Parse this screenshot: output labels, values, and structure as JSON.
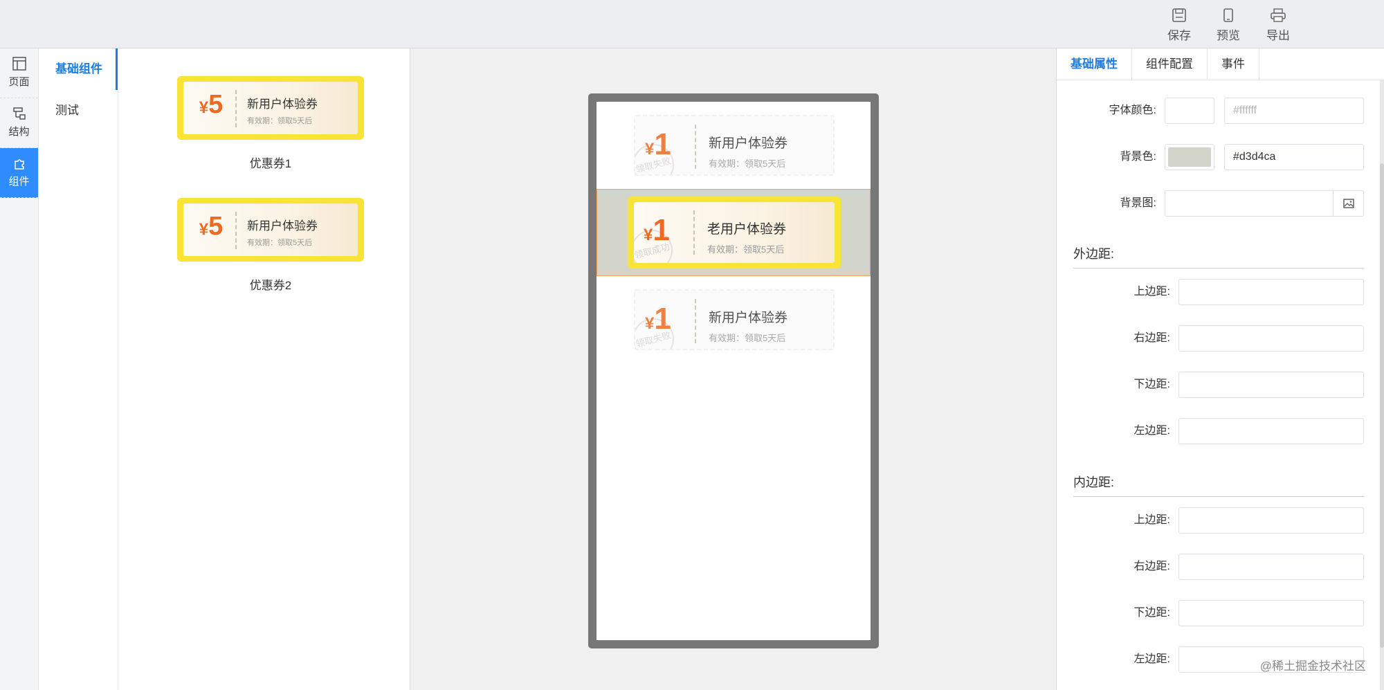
{
  "toolbar": {
    "save": "保存",
    "preview": "预览",
    "export": "导出"
  },
  "rail": {
    "page": "页面",
    "structure": "结构",
    "component": "组件"
  },
  "categories": [
    "基础组件",
    "测试"
  ],
  "library": [
    {
      "yen": "¥",
      "amount": "5",
      "title": "新用户体验券",
      "sub": "有效期：领取5天后",
      "label": "优惠券1"
    },
    {
      "yen": "¥",
      "amount": "5",
      "title": "新用户体验券",
      "sub": "有效期：领取5天后",
      "label": "优惠券2"
    }
  ],
  "canvas": [
    {
      "yen": "¥",
      "amount": "1",
      "title": "新用户体验券",
      "sub": "有效期：领取5天后",
      "stamp": "领取失败"
    },
    {
      "yen": "¥",
      "amount": "1",
      "title": "老用户体验券",
      "sub": "有效期：领取5天后",
      "stamp": "领取成功"
    },
    {
      "yen": "¥",
      "amount": "1",
      "title": "新用户体验券",
      "sub": "有效期：领取5天后",
      "stamp": "领取失败"
    }
  ],
  "props": {
    "tabs": [
      "基础属性",
      "组件配置",
      "事件"
    ],
    "font_color_label": "字体颜色:",
    "font_color_placeholder": "#ffffff",
    "bg_color_label": "背景色:",
    "bg_color_value": "#d3d4ca",
    "bg_image_label": "背景图:",
    "margin_title": "外边距:",
    "padding_title": "内边距:",
    "top": "上边距:",
    "right": "右边距:",
    "bottom": "下边距:",
    "left": "左边距:"
  },
  "colors": {
    "accent": "#1f7de0",
    "active_rail": "#2f8cff",
    "coupon_border": "#f9e334",
    "price": "#ee6a22",
    "selected_bg": "#d3d4ca",
    "selected_border": "#f4a25a"
  },
  "watermark": "@稀土掘金技术社区"
}
